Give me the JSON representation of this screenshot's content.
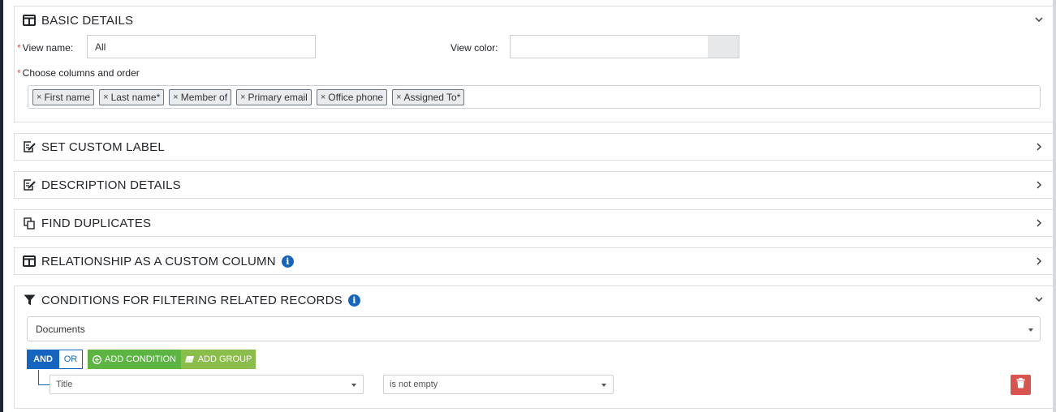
{
  "basic_details": {
    "title": "BASIC DETAILS",
    "view_name_label": "View name:",
    "view_name_value": "All",
    "view_color_label": "View color:",
    "view_color_value": "",
    "columns_label": "Choose columns and order",
    "required_marker": "*",
    "columns": [
      {
        "remove": "×",
        "label": "First name"
      },
      {
        "remove": "×",
        "label": "Last name*"
      },
      {
        "remove": "×",
        "label": "Member of"
      },
      {
        "remove": "×",
        "label": "Primary email"
      },
      {
        "remove": "×",
        "label": "Office phone"
      },
      {
        "remove": "×",
        "label": "Assigned To*"
      }
    ]
  },
  "sections": {
    "custom_label": "SET CUSTOM LABEL",
    "description": "DESCRIPTION DETAILS",
    "duplicates": "FIND DUPLICATES",
    "relationship": "RELATIONSHIP AS A CUSTOM COLUMN"
  },
  "conditions": {
    "title": "CONDITIONS FOR FILTERING RELATED RECORDS",
    "module_select": "Documents",
    "and_label": "AND",
    "or_label": "OR",
    "add_condition_label": "ADD CONDITION",
    "add_group_label": "ADD GROUP",
    "rule": {
      "field": "Title",
      "operator": "is not empty"
    }
  },
  "colors": {
    "primary": "#1565c0",
    "success": "#5cb443",
    "success_light": "#8bbd4a",
    "danger": "#d9534f"
  },
  "icons": {
    "info": "i"
  }
}
